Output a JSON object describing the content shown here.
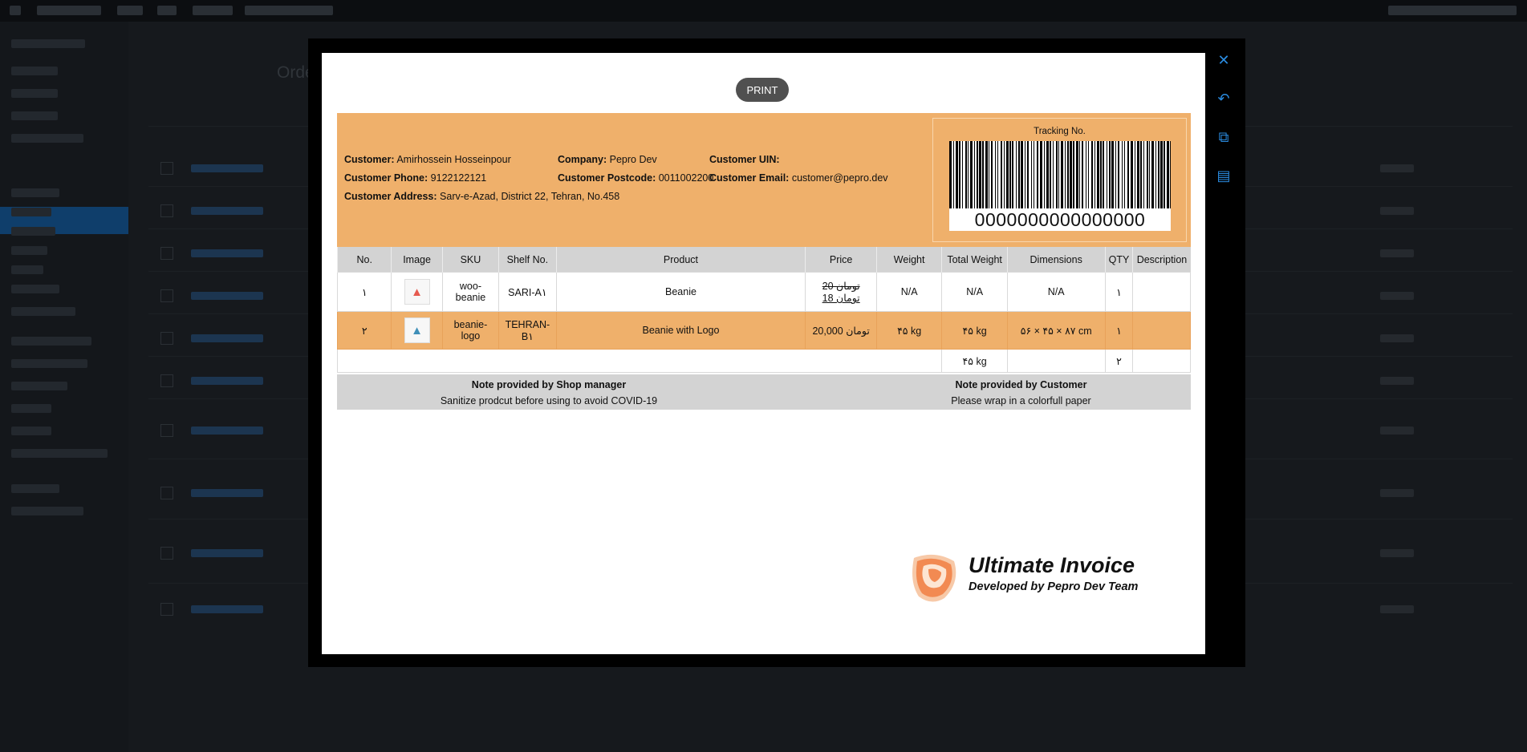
{
  "print_label": "PRINT",
  "side_icons": [
    "close-icon",
    "undo-icon",
    "external-link-icon",
    "document-icon"
  ],
  "side_glyphs": [
    "✕",
    "↶",
    "⧉",
    "▤"
  ],
  "customer": {
    "name_label": "Customer:",
    "name": "Amirhossein Hosseinpour",
    "company_label": "Company:",
    "company": "Pepro Dev",
    "uin_label": "Customer UIN:",
    "uin": "",
    "phone_label": "Customer Phone:",
    "phone": "9122122121",
    "postcode_label": "Customer Postcode:",
    "postcode": "0011002200",
    "email_label": "Customer Email:",
    "email": "customer@pepro.dev",
    "address_label": "Customer Address:",
    "address": "Sarv-e-Azad, District 22, Tehran, No.458"
  },
  "tracking": {
    "label": "Tracking No.",
    "number": "0000000000000000"
  },
  "table": {
    "headers": [
      "No.",
      "Image",
      "SKU",
      "Shelf No.",
      "Product",
      "Price",
      "Weight",
      "Total Weight",
      "Dimensions",
      "QTY",
      "Description"
    ],
    "rows": [
      {
        "no": "۱",
        "sku": "woo-beanie",
        "shelf": "SARI-A۱",
        "product": "Beanie",
        "price_old": "20 تومان",
        "price_new": "18 تومان",
        "weight": "N/A",
        "total_weight": "N/A",
        "dimensions": "N/A",
        "qty": "۱",
        "description": "",
        "image_icon": "beanie-image-icon"
      },
      {
        "no": "۲",
        "sku": "beanie-logo",
        "shelf": "TEHRAN-B۱",
        "product": "Beanie with Logo",
        "price": "20,000 تومان",
        "weight": "۴۵ kg",
        "total_weight": "۴۵ kg",
        "dimensions": "۵۶ × ۴۵ × ۸۷ cm",
        "qty": "۱",
        "description": "",
        "image_icon": "beanie-logo-image-icon"
      }
    ],
    "totals": {
      "total_weight": "۴۵ kg",
      "qty": "۲"
    }
  },
  "notes": {
    "shop_title": "Note provided by Shop manager",
    "shop_text": "Sanitize prodcut before using to avoid COVID-19",
    "customer_title": "Note provided by Customer",
    "customer_text": "Please wrap in a colorfull paper"
  },
  "logo": {
    "title": "Ultimate Invoice",
    "subtitle": "Developed by Pepro Dev Team"
  },
  "background": {
    "page_title": "Orders"
  },
  "colors": {
    "header_bg": "#efb06b",
    "accent": "#2a8be0",
    "print_btn": "#505050"
  }
}
